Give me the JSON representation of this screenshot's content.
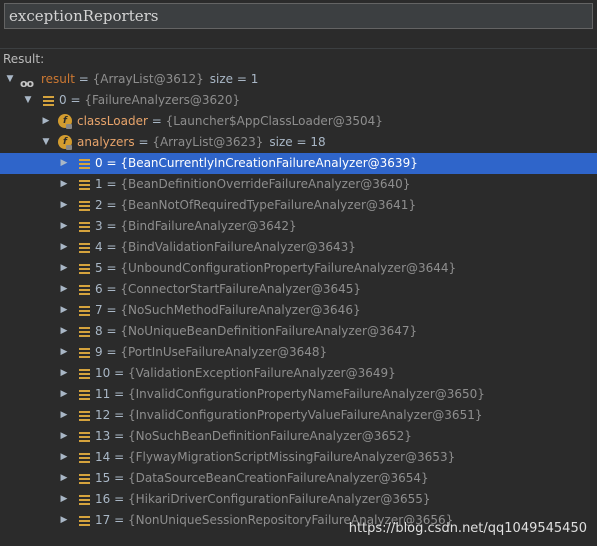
{
  "expression": "exceptionReporters",
  "result_label": "Result:",
  "root": {
    "name": "result",
    "eq": " = ",
    "value": "{ArrayList@3612}",
    "size": "size = 1"
  },
  "item0": {
    "name": "0",
    "eq": " = ",
    "value": "{FailureAnalyzers@3620}"
  },
  "classLoader": {
    "name": "classLoader",
    "eq": " = ",
    "value": "{Launcher$AppClassLoader@3504}"
  },
  "analyzers": {
    "name": "analyzers",
    "eq": " = ",
    "value": "{ArrayList@3623}",
    "size": "size = 18"
  },
  "items": [
    {
      "idx": "0",
      "value": "{BeanCurrentlyInCreationFailureAnalyzer@3639}"
    },
    {
      "idx": "1",
      "value": "{BeanDefinitionOverrideFailureAnalyzer@3640}"
    },
    {
      "idx": "2",
      "value": "{BeanNotOfRequiredTypeFailureAnalyzer@3641}"
    },
    {
      "idx": "3",
      "value": "{BindFailureAnalyzer@3642}"
    },
    {
      "idx": "4",
      "value": "{BindValidationFailureAnalyzer@3643}"
    },
    {
      "idx": "5",
      "value": "{UnboundConfigurationPropertyFailureAnalyzer@3644}"
    },
    {
      "idx": "6",
      "value": "{ConnectorStartFailureAnalyzer@3645}"
    },
    {
      "idx": "7",
      "value": "{NoSuchMethodFailureAnalyzer@3646}"
    },
    {
      "idx": "8",
      "value": "{NoUniqueBeanDefinitionFailureAnalyzer@3647}"
    },
    {
      "idx": "9",
      "value": "{PortInUseFailureAnalyzer@3648}"
    },
    {
      "idx": "10",
      "value": "{ValidationExceptionFailureAnalyzer@3649}"
    },
    {
      "idx": "11",
      "value": "{InvalidConfigurationPropertyNameFailureAnalyzer@3650}"
    },
    {
      "idx": "12",
      "value": "{InvalidConfigurationPropertyValueFailureAnalyzer@3651}"
    },
    {
      "idx": "13",
      "value": "{NoSuchBeanDefinitionFailureAnalyzer@3652}"
    },
    {
      "idx": "14",
      "value": "{FlywayMigrationScriptMissingFailureAnalyzer@3653}"
    },
    {
      "idx": "15",
      "value": "{DataSourceBeanCreationFailureAnalyzer@3654}"
    },
    {
      "idx": "16",
      "value": "{HikariDriverConfigurationFailureAnalyzer@3655}"
    },
    {
      "idx": "17",
      "value": "{NonUniqueSessionRepositoryFailureAnalyzer@3656}"
    }
  ],
  "selected_index": 0,
  "watermark": "https://blog.csdn.net/qq1049545450"
}
